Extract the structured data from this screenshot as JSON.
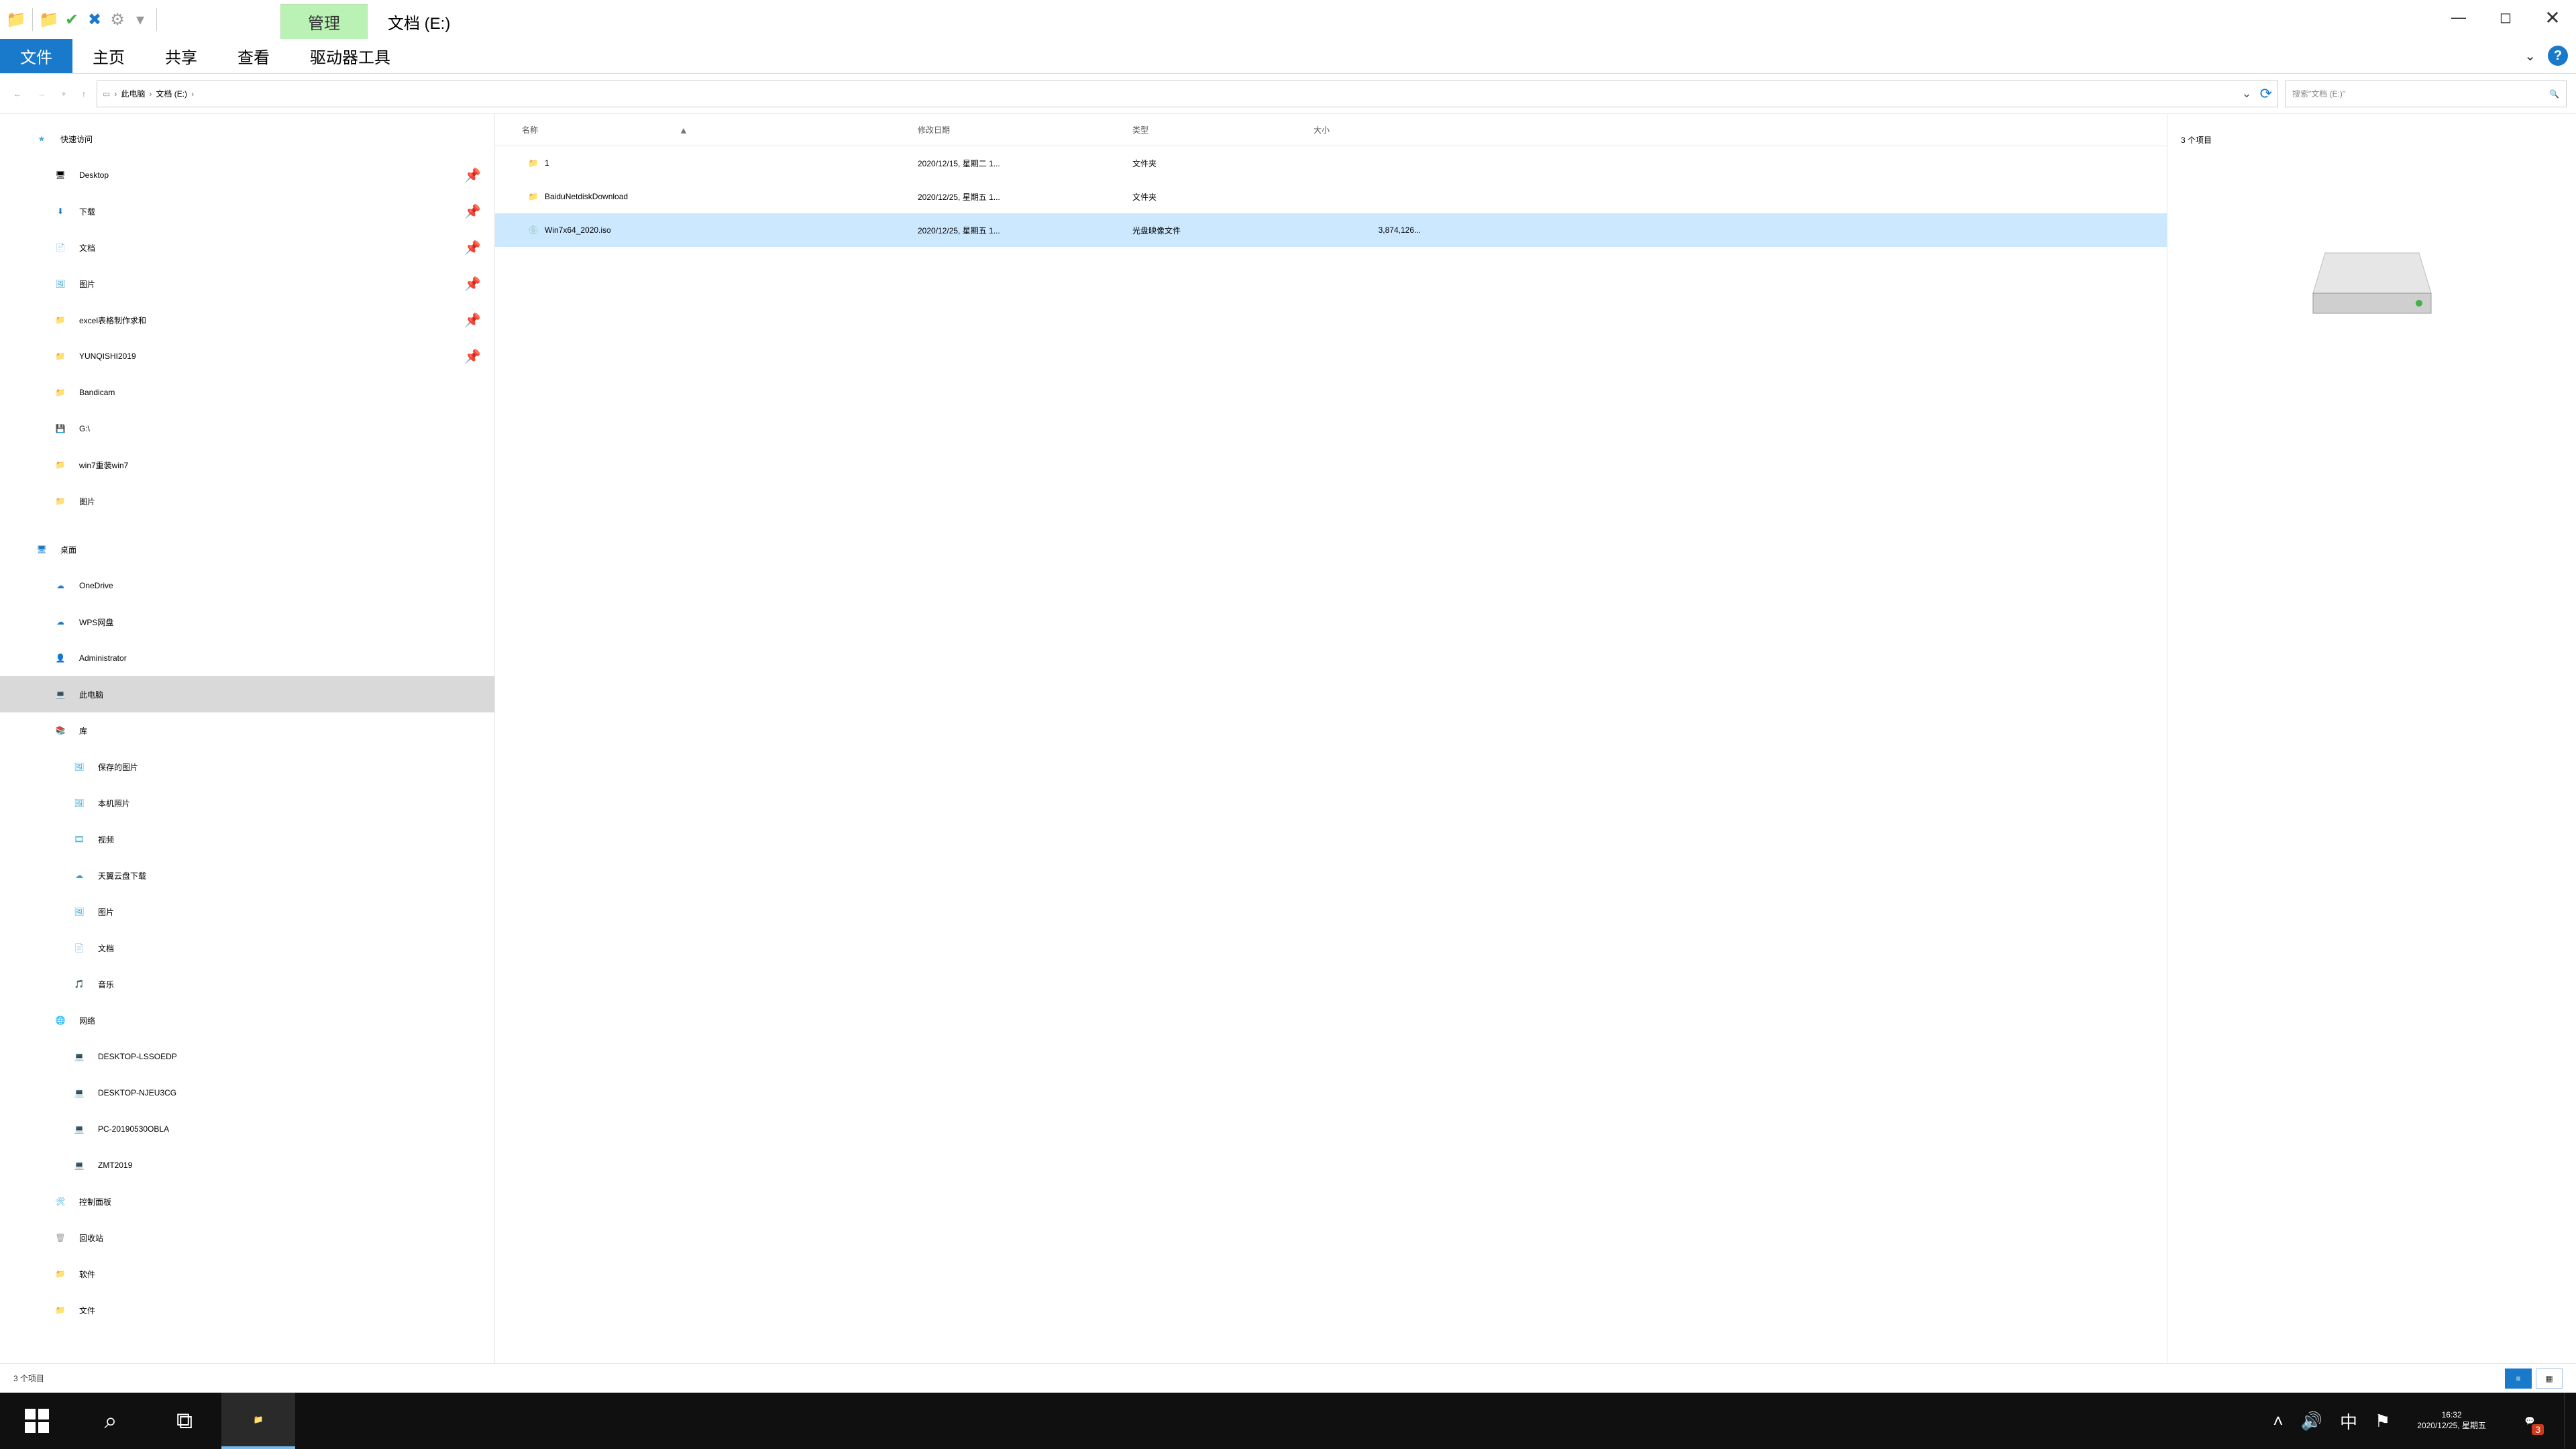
{
  "titlebar": {
    "context_tab": "管理",
    "title": "文档 (E:)"
  },
  "ribbon": {
    "file": "文件",
    "tabs": [
      "主页",
      "共享",
      "查看",
      "驱动器工具"
    ]
  },
  "nav": {
    "breadcrumb": [
      "此电脑",
      "文档 (E:)"
    ],
    "search_placeholder": "搜索\"文档 (E:)\""
  },
  "tree": {
    "quick_access": "快速访问",
    "quick_items": [
      {
        "icon": "🖥",
        "label": "Desktop",
        "pin": true
      },
      {
        "icon": "⬇",
        "label": "下载",
        "pin": true,
        "cls": "blue"
      },
      {
        "icon": "📄",
        "label": "文档",
        "pin": true,
        "cls": "cyan"
      },
      {
        "icon": "🖼",
        "label": "图片",
        "pin": true,
        "cls": "cyan"
      },
      {
        "icon": "📁",
        "label": "excel表格制作求和",
        "pin": true,
        "cls": "fld"
      },
      {
        "icon": "📁",
        "label": "YUNQISHI2019",
        "pin": true,
        "cls": "fld"
      },
      {
        "icon": "📁",
        "label": "Bandicam",
        "cls": "fld"
      },
      {
        "icon": "💾",
        "label": "G:\\",
        "cls": "blue"
      },
      {
        "icon": "📁",
        "label": "win7重装win7",
        "cls": "fld"
      },
      {
        "icon": "📁",
        "label": "图片",
        "cls": "fld"
      }
    ],
    "desktop": "桌面",
    "desktop_items": [
      {
        "icon": "☁",
        "label": "OneDrive",
        "cls": "blue"
      },
      {
        "icon": "☁",
        "label": "WPS网盘",
        "cls": "blue"
      },
      {
        "icon": "👤",
        "label": "Administrator",
        "cls": "fld"
      },
      {
        "icon": "💻",
        "label": "此电脑",
        "sel": true,
        "cls": "blue"
      },
      {
        "icon": "📚",
        "label": "库",
        "cls": "cyan"
      }
    ],
    "lib_items": [
      {
        "icon": "🖼",
        "label": "保存的图片",
        "cls": "cyan"
      },
      {
        "icon": "🖼",
        "label": "本机照片",
        "cls": "cyan"
      },
      {
        "icon": "🎞",
        "label": "视频",
        "cls": "cyan"
      },
      {
        "icon": "☁",
        "label": "天翼云盘下载",
        "cls": "cyan"
      },
      {
        "icon": "🖼",
        "label": "图片",
        "cls": "cyan"
      },
      {
        "icon": "📄",
        "label": "文档",
        "cls": "cyan"
      },
      {
        "icon": "🎵",
        "label": "音乐",
        "cls": "cyan"
      }
    ],
    "network": "网络",
    "network_items": [
      {
        "icon": "💻",
        "label": "DESKTOP-LSSOEDP",
        "cls": "cyan"
      },
      {
        "icon": "💻",
        "label": "DESKTOP-NJEU3CG",
        "cls": "cyan"
      },
      {
        "icon": "💻",
        "label": "PC-20190530OBLA",
        "cls": "cyan"
      },
      {
        "icon": "💻",
        "label": "ZMT2019",
        "cls": "cyan"
      }
    ],
    "control_panel": "控制面板",
    "recycle": "回收站",
    "soft": "软件",
    "docs": "文件"
  },
  "columns": {
    "name": "名称",
    "date": "修改日期",
    "type": "类型",
    "size": "大小"
  },
  "rows": [
    {
      "icon": "📁",
      "name": "1",
      "date": "2020/12/15, 星期二 1...",
      "type": "文件夹",
      "size": "",
      "cls": "fld"
    },
    {
      "icon": "📁",
      "name": "BaiduNetdiskDownload",
      "date": "2020/12/25, 星期五 1...",
      "type": "文件夹",
      "size": "",
      "cls": "fld"
    },
    {
      "icon": "💿",
      "name": "Win7x64_2020.iso",
      "date": "2020/12/25, 星期五 1...",
      "type": "光盘映像文件",
      "size": "3,874,126...",
      "sel": true,
      "cls": "gray"
    }
  ],
  "preview": {
    "count": "3 个项目"
  },
  "status": {
    "text": "3 个项目"
  },
  "taskbar": {
    "time": "16:32",
    "date": "2020/12/25, 星期五",
    "ime": "中",
    "notif_count": "3"
  }
}
